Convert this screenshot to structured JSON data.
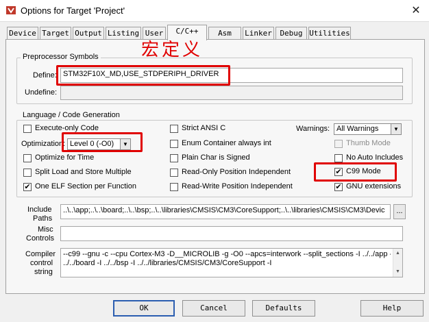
{
  "window": {
    "title": "Options for Target 'Project'",
    "close_glyph": "✕"
  },
  "tabs": [
    {
      "label": "Device"
    },
    {
      "label": "Target"
    },
    {
      "label": "Output"
    },
    {
      "label": "Listing"
    },
    {
      "label": "User"
    },
    {
      "label": "C/C++",
      "active": true
    },
    {
      "label": "Asm"
    },
    {
      "label": "Linker"
    },
    {
      "label": "Debug"
    },
    {
      "label": "Utilities"
    }
  ],
  "preprocessor": {
    "title": "Preprocessor Symbols",
    "annotation": "宏定义",
    "define_label": "Define:",
    "define_value": "STM32F10X_MD,USE_STDPERIPH_DRIVER",
    "undefine_label": "Undefine:",
    "undefine_value": ""
  },
  "codegen": {
    "title": "Language / Code Generation",
    "execute_only": {
      "label": "Execute-only Code",
      "checked": false
    },
    "optimization_label": "Optimization:",
    "optimization_value": "Level 0 (-O0)",
    "optimize_time": {
      "label": "Optimize for Time",
      "checked": false
    },
    "split_load": {
      "label": "Split Load and Store Multiple",
      "checked": false
    },
    "one_elf": {
      "label": "One ELF Section per Function",
      "checked": true
    },
    "strict_ansi": {
      "label": "Strict ANSI C",
      "checked": false
    },
    "enum_container": {
      "label": "Enum Container always int",
      "checked": false
    },
    "plain_char": {
      "label": "Plain Char is Signed",
      "checked": false
    },
    "ro_position": {
      "label": "Read-Only Position Independent",
      "checked": false
    },
    "rw_position": {
      "label": "Read-Write Position Independent",
      "checked": false
    },
    "warnings_label": "Warnings:",
    "warnings_value": "All Warnings",
    "thumb_mode": {
      "label": "Thumb Mode",
      "checked": false,
      "disabled": true
    },
    "no_auto_includes": {
      "label": "No Auto Includes",
      "checked": false
    },
    "c99_mode": {
      "label": "C99 Mode",
      "checked": true
    },
    "gnu_ext": {
      "label": "GNU extensions",
      "checked": true
    },
    "check_glyph": "✔"
  },
  "paths": {
    "include_label_1": "Include",
    "include_label_2": "Paths",
    "include_value": "..\\..\\app;..\\..\\board;..\\..\\bsp;..\\..\\libraries\\CMSIS\\CM3\\CoreSupport;..\\..\\libraries\\CMSIS\\CM3\\Devic",
    "browse_label": "...",
    "misc_label_1": "Misc",
    "misc_label_2": "Controls",
    "misc_value": "",
    "compiler_label_1": "Compiler",
    "compiler_label_2": "control",
    "compiler_label_3": "string",
    "compiler_line_1": "--c99 --gnu -c --cpu Cortex-M3 -D__MICROLIB -g -O0 --apcs=interwork --split_sections -I ../../app -I",
    "compiler_line_2": "../../board -I ../../bsp -I ../../libraries/CMSIS/CM3/CoreSupport -I"
  },
  "buttons": {
    "ok": "OK",
    "cancel": "Cancel",
    "defaults": "Defaults",
    "help": "Help"
  },
  "colors": {
    "annotation_red": "#e00000",
    "icon_red": "#c0392b"
  }
}
